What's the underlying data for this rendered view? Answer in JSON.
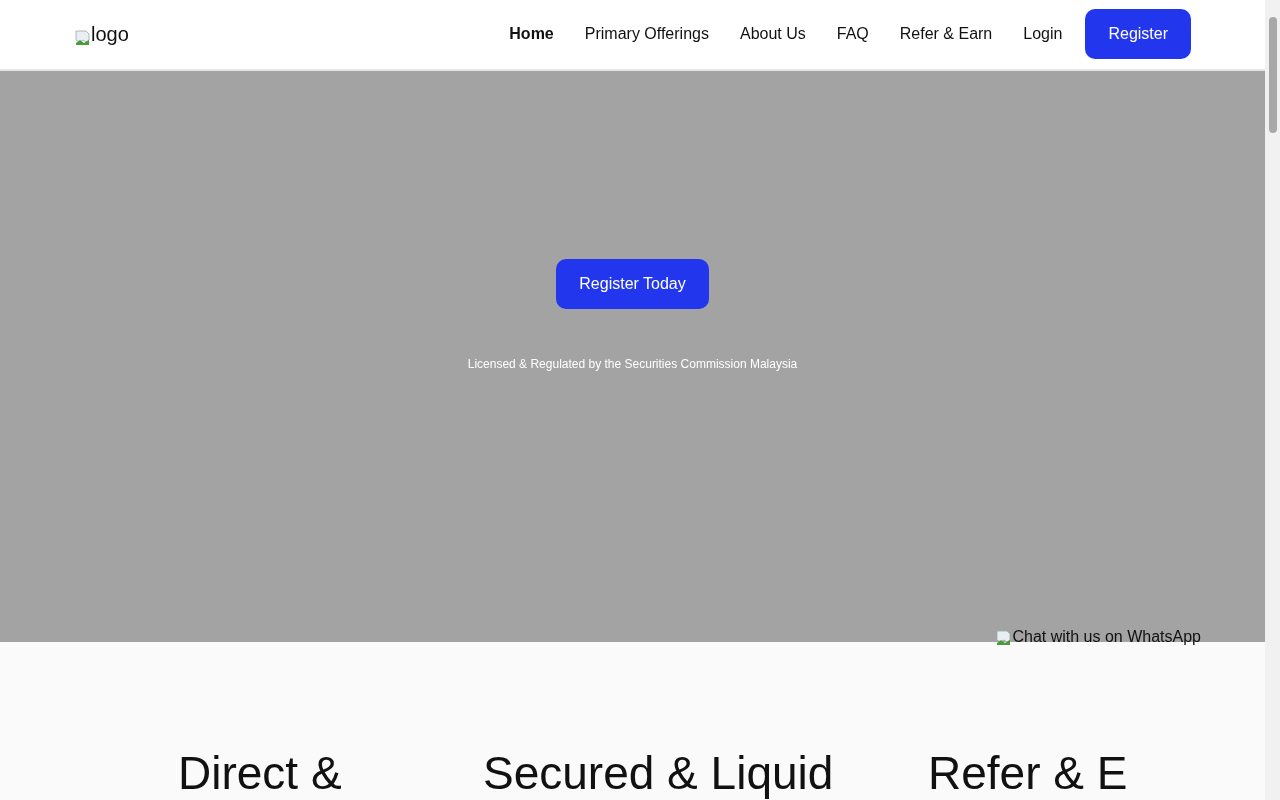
{
  "header": {
    "logo_alt": "logo",
    "nav": [
      {
        "label": "Home",
        "selected": true
      },
      {
        "label": "Primary Offerings",
        "selected": false
      },
      {
        "label": "About Us",
        "selected": false
      },
      {
        "label": "FAQ",
        "selected": false
      },
      {
        "label": "Refer & Earn",
        "selected": false
      },
      {
        "label": "Login",
        "selected": false
      }
    ],
    "register_button": "Register"
  },
  "hero": {
    "cta_button": "Register Today",
    "license_note": "Licensed & Regulated by the Securities Commission Malaysia",
    "whatsapp_alt": "Chat with us on WhatsApp"
  },
  "features": {
    "headings": [
      "Direct &",
      "Secured & Liquid",
      "Refer & E"
    ]
  }
}
